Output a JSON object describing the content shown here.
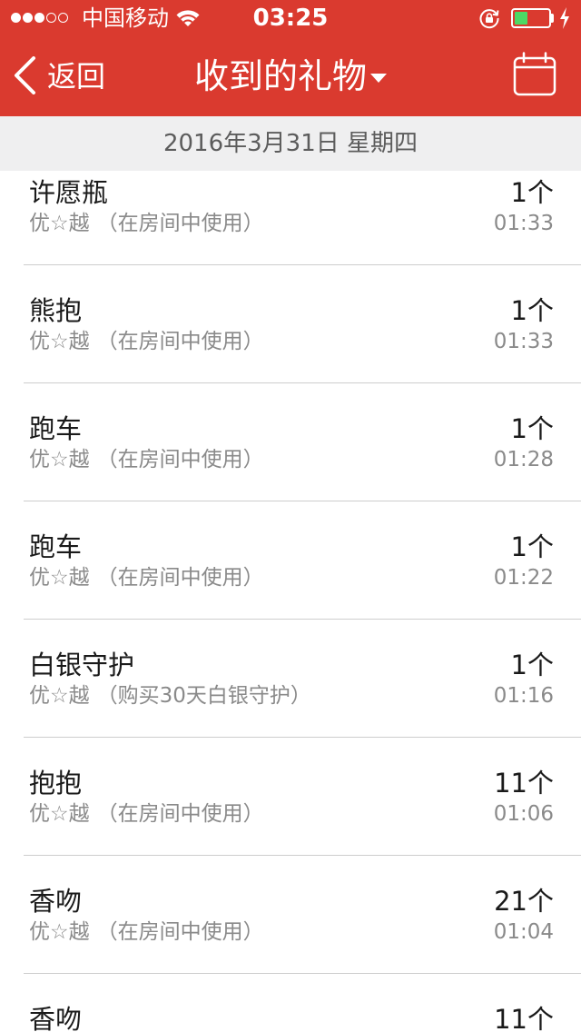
{
  "theme": {
    "accent": "#DA3A2F",
    "battery_fill": "#4CD964"
  },
  "status_bar": {
    "signal_strength": 3,
    "signal_max": 5,
    "carrier": "中国移动",
    "wifi_icon": "wifi-icon",
    "time": "03:25",
    "rotation_lock_icon": "orientation-lock-icon",
    "battery_level": 0.4,
    "charging_icon": "charging-bolt-icon"
  },
  "nav": {
    "back_icon": "chevron-left-icon",
    "back_label": "返回",
    "title": "收到的礼物",
    "title_dropdown_icon": "caret-down-icon",
    "calendar_icon": "calendar-icon"
  },
  "section": {
    "date": "2016年3月31日 星期四"
  },
  "gifts": [
    {
      "name": "许愿瓶",
      "user": "优☆越",
      "note": "（在房间中使用）",
      "count": "1个",
      "time": "01:33"
    },
    {
      "name": "熊抱",
      "user": "优☆越",
      "note": "（在房间中使用）",
      "count": "1个",
      "time": "01:33"
    },
    {
      "name": "跑车",
      "user": "优☆越",
      "note": "（在房间中使用）",
      "count": "1个",
      "time": "01:28"
    },
    {
      "name": "跑车",
      "user": "优☆越",
      "note": "（在房间中使用）",
      "count": "1个",
      "time": "01:22"
    },
    {
      "name": "白银守护",
      "user": "优☆越",
      "note": "（购买30天白银守护）",
      "count": "1个",
      "time": "01:16"
    },
    {
      "name": "抱抱",
      "user": "优☆越",
      "note": "（在房间中使用）",
      "count": "11个",
      "time": "01:06"
    },
    {
      "name": "香吻",
      "user": "优☆越",
      "note": "（在房间中使用）",
      "count": "21个",
      "time": "01:04"
    },
    {
      "name": "香吻",
      "count": "11个"
    }
  ]
}
